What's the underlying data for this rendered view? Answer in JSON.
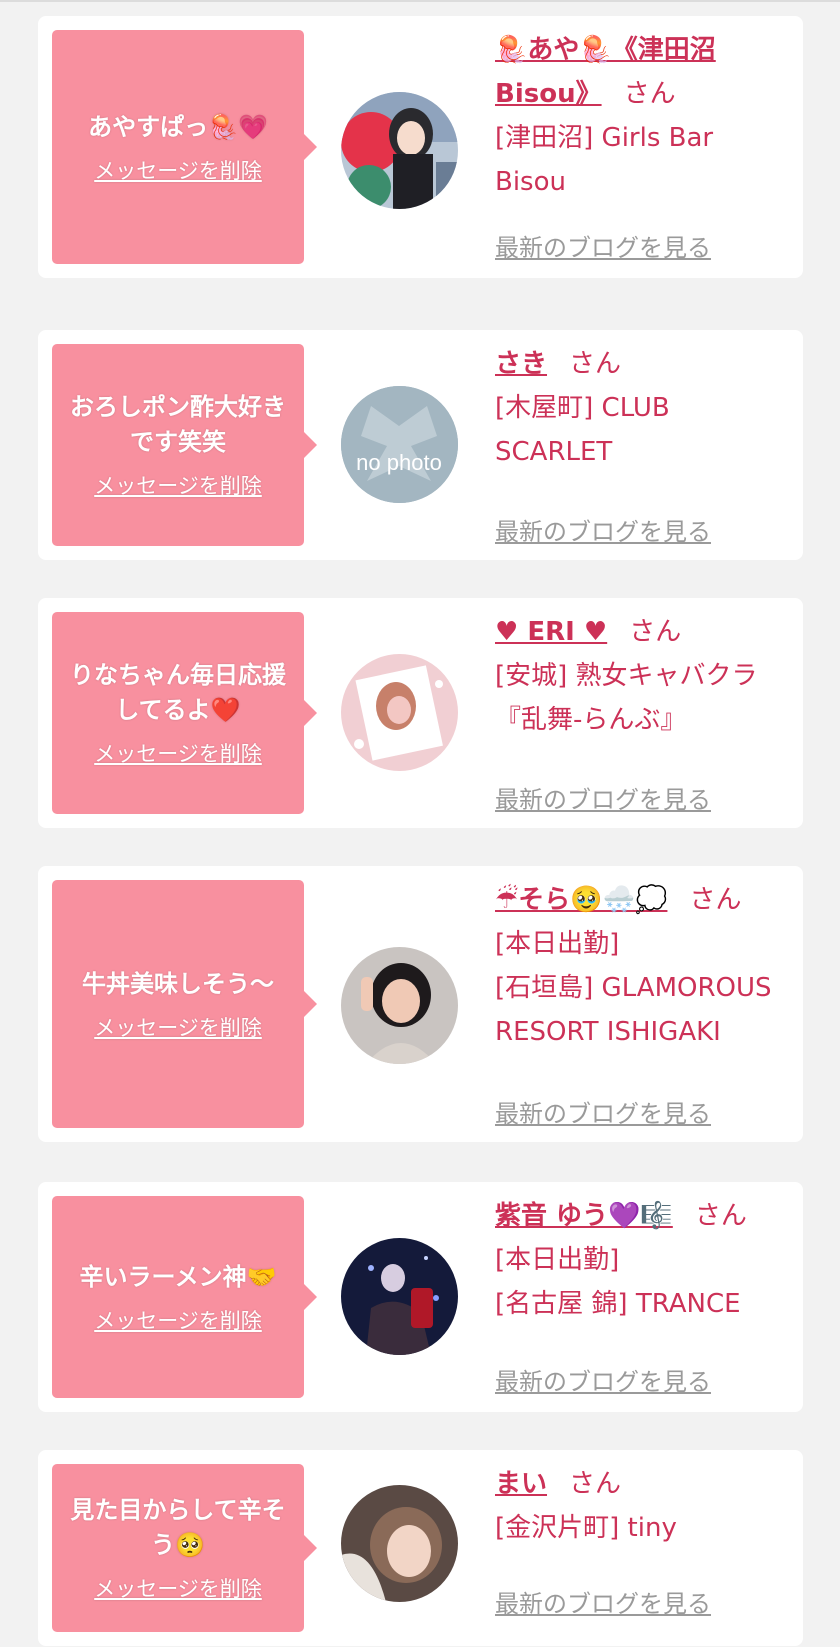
{
  "delete_label": "メッセージを削除",
  "blog_label": "最新のブログを見る",
  "san": "さん",
  "cards": [
    {
      "message": "あやすぱっ🪼💗",
      "name_line1": "🪼あや🪼《津田沼",
      "name_line2": "Bisou》",
      "lines": [
        "[津田沼] Girls Bar",
        "Bisou"
      ]
    },
    {
      "message": "おろしポン酢大好きです笑笑",
      "name": "さき",
      "lines": [
        "[木屋町] CLUB",
        "SCARLET"
      ],
      "avatar_text": "no photo"
    },
    {
      "message": "りなちゃん毎日応援してるよ❤️",
      "name": "♥ ERI ♥",
      "lines": [
        "[安城] 熟女キャバクラ",
        "『乱舞-らんぶ』"
      ]
    },
    {
      "message": "牛丼美味しそう〜",
      "name": "☔そら🥹🌨️💭",
      "lines": [
        "[本日出勤]",
        "[石垣島] GLAMOROUS",
        "RESORT ISHIGAKI"
      ]
    },
    {
      "message": "辛いラーメン神🤝",
      "name": "紫音 ゆう💜🎼",
      "lines": [
        "[本日出勤]",
        "[名古屋 錦] TRANCE"
      ]
    },
    {
      "message": "見た目からして辛そう🥺",
      "name": "まい",
      "lines": [
        "[金沢片町] tiny"
      ]
    }
  ],
  "colors": {
    "background": "#f2f2f2",
    "bubble": "#f8909f",
    "accent": "#cc3157",
    "link_gray": "#9a9a9a"
  }
}
